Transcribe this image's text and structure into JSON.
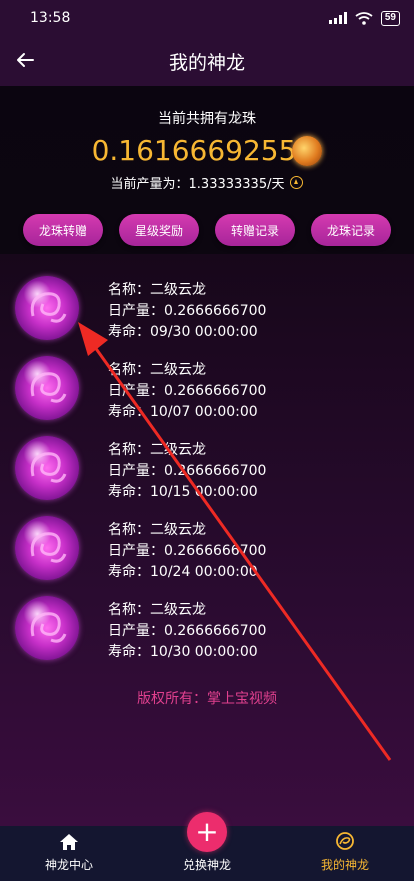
{
  "status_bar": {
    "time": "13:58",
    "battery": "59"
  },
  "header": {
    "title": "我的神龙"
  },
  "summary": {
    "label": "当前共拥有龙珠",
    "total": "0.1616669255",
    "rate_text": "当前产量为：1.33333335/天"
  },
  "actions": [
    {
      "label": "龙珠转赠"
    },
    {
      "label": "星级奖励"
    },
    {
      "label": "转赠记录"
    },
    {
      "label": "龙珠记录"
    }
  ],
  "dragons": [
    {
      "name": "名称：二级云龙",
      "daily": "日产量：0.2666666700",
      "life": "寿命：09/30 00:00:00"
    },
    {
      "name": "名称：二级云龙",
      "daily": "日产量：0.2666666700",
      "life": "寿命：10/07 00:00:00"
    },
    {
      "name": "名称：二级云龙",
      "daily": "日产量：0.2666666700",
      "life": "寿命：10/15 00:00:00"
    },
    {
      "name": "名称：二级云龙",
      "daily": "日产量：0.2666666700",
      "life": "寿命：10/24 00:00:00"
    },
    {
      "name": "名称：二级云龙",
      "daily": "日产量：0.2666666700",
      "life": "寿命：10/30 00:00:00"
    }
  ],
  "copyright": "版权所有：掌上宝视频",
  "bottom_nav": [
    {
      "label": "神龙中心",
      "icon": "home-icon"
    },
    {
      "label": "兑换神龙",
      "icon": "plus-icon"
    },
    {
      "label": "我的神龙",
      "icon": "dragon-icon"
    }
  ],
  "colors": {
    "accent_gold": "#f7b733",
    "button_pink": "#d53ab0",
    "fab": "#ec2d6d",
    "annotation_arrow": "#ee2a24"
  }
}
